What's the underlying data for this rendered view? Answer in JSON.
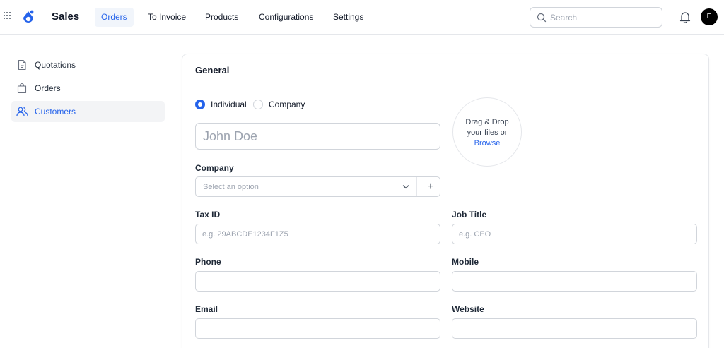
{
  "app": {
    "name": "Sales"
  },
  "nav": {
    "items": [
      {
        "label": "Orders",
        "active": true
      },
      {
        "label": "To Invoice",
        "active": false
      },
      {
        "label": "Products",
        "active": false
      },
      {
        "label": "Configurations",
        "active": false
      },
      {
        "label": "Settings",
        "active": false
      }
    ]
  },
  "search": {
    "placeholder": "Search",
    "value": ""
  },
  "user": {
    "initial": "E"
  },
  "sidebar": {
    "items": [
      {
        "label": "Quotations",
        "icon": "document-icon",
        "active": false
      },
      {
        "label": "Orders",
        "icon": "shopping-bag-icon",
        "active": false
      },
      {
        "label": "Customers",
        "icon": "users-icon",
        "active": true
      }
    ]
  },
  "form": {
    "section_title": "General",
    "type_options": [
      {
        "label": "Individual",
        "selected": true
      },
      {
        "label": "Company",
        "selected": false
      }
    ],
    "name_placeholder": "John Doe",
    "company": {
      "label": "Company",
      "placeholder": "Select an option"
    },
    "tax_id": {
      "label": "Tax ID",
      "placeholder": "e.g. 29ABCDE1234F1Z5"
    },
    "job_title": {
      "label": "Job Title",
      "placeholder": "e.g. CEO"
    },
    "phone": {
      "label": "Phone",
      "placeholder": ""
    },
    "mobile": {
      "label": "Mobile",
      "placeholder": ""
    },
    "email": {
      "label": "Email",
      "placeholder": ""
    },
    "website": {
      "label": "Website",
      "placeholder": ""
    },
    "upload": {
      "line1": "Drag & Drop",
      "line2": "your files or",
      "link": "Browse"
    }
  },
  "colors": {
    "accent": "#2563eb",
    "border": "#d1d5db",
    "text": "#111827"
  }
}
